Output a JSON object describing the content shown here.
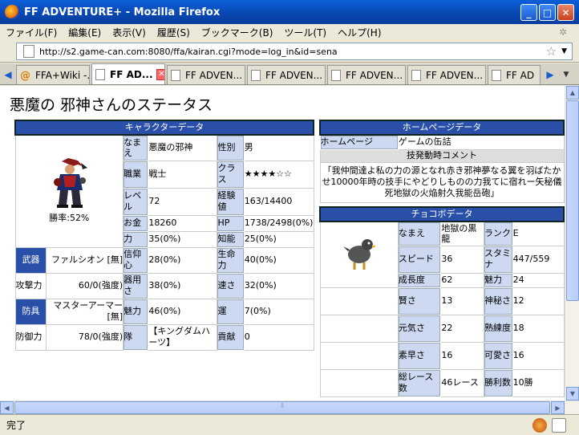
{
  "window": {
    "title": "FF ADVENTURE+ - Mozilla Firefox"
  },
  "menu": [
    "ファイル(F)",
    "編集(E)",
    "表示(V)",
    "履歴(S)",
    "ブックマーク(B)",
    "ツール(T)",
    "ヘルプ(H)"
  ],
  "address": {
    "url": "http://s2.game-can.com:8080/ffa/kairan.cgi?mode=log_in&id=sena"
  },
  "tabs": [
    {
      "label": "FFA+Wiki -..."
    },
    {
      "label": "FF AD..."
    },
    {
      "label": "FF ADVEN..."
    },
    {
      "label": "FF ADVEN..."
    },
    {
      "label": "FF ADVEN..."
    },
    {
      "label": "FF ADVEN..."
    },
    {
      "label": "FF AD"
    }
  ],
  "status": {
    "text": "完了"
  },
  "page": {
    "title": "悪魔の 邪神さんのステータス",
    "char": {
      "header": "キャラクターデータ",
      "winrate": "勝率:52%",
      "rows": [
        {
          "l1": "なまえ",
          "v1": "悪魔の邪神",
          "l2": "性別",
          "v2": "男"
        },
        {
          "l1": "職業",
          "v1": "戦士",
          "l2": "クラス",
          "v2": "★★★★☆☆"
        },
        {
          "l1": "レベル",
          "v1": "72",
          "l2": "経験値",
          "v2": "163/14400"
        },
        {
          "l1": "お金",
          "v1": "18260",
          "l2": "HP",
          "v2": "1738/2498(0%)"
        },
        {
          "l1": "力",
          "v1": "35(0%)",
          "l2": "知能",
          "v2": "25(0%)"
        }
      ],
      "equip": [
        {
          "lab": "武器",
          "val": "ファルシオン [無]",
          "l1": "信仰心",
          "v1": "28(0%)",
          "l2": "生命力",
          "v2": "40(0%)",
          "blue": true
        },
        {
          "lab": "攻撃力",
          "val": "60/0(強度)",
          "l1": "器用さ",
          "v1": "38(0%)",
          "l2": "速さ",
          "v2": "32(0%)",
          "blue": false
        },
        {
          "lab": "防具",
          "val": "マスターアーマー [無]",
          "l1": "魅力",
          "v1": "46(0%)",
          "l2": "運",
          "v2": "7(0%)",
          "blue": true
        },
        {
          "lab": "防御力",
          "val": "78/0(強度)",
          "l1": "隊",
          "v1": "【キングダムハーツ】",
          "l2": "貢献",
          "v2": "0",
          "blue": false
        }
      ]
    },
    "home": {
      "header": "ホームページデータ",
      "label": "ホームページ",
      "value": "ゲームの缶詰",
      "comment_header": "技発動時コメント",
      "comment": "「我仲間達よ私の力の源となれ赤き邪神夢なる翼を羽ばたかせ10000年時の技手にやどりしものの力我てに宿れー矢秘儀死地獄の火焔射久我能岳砲」"
    },
    "choco": {
      "header": "チョコボデータ",
      "rows": [
        {
          "l1": "なまえ",
          "v1": "地獄の黒龍",
          "l2": "ランク",
          "v2": "E"
        },
        {
          "l1": "スピード",
          "v1": "36",
          "l2": "スタミナ",
          "v2": "447/559"
        },
        {
          "l1": "成長度",
          "v1": "62",
          "l2": "魅力",
          "v2": "24"
        },
        {
          "l1": "賢さ",
          "v1": "13",
          "l2": "神秘さ",
          "v2": "12"
        },
        {
          "l1": "元気さ",
          "v1": "22",
          "l2": "熟練度",
          "v2": "18"
        },
        {
          "l1": "素早さ",
          "v1": "16",
          "l2": "可愛さ",
          "v2": "16"
        },
        {
          "l1": "総レース数",
          "v1": "46レース",
          "l2": "勝利数",
          "v2": "10勝"
        }
      ]
    }
  }
}
